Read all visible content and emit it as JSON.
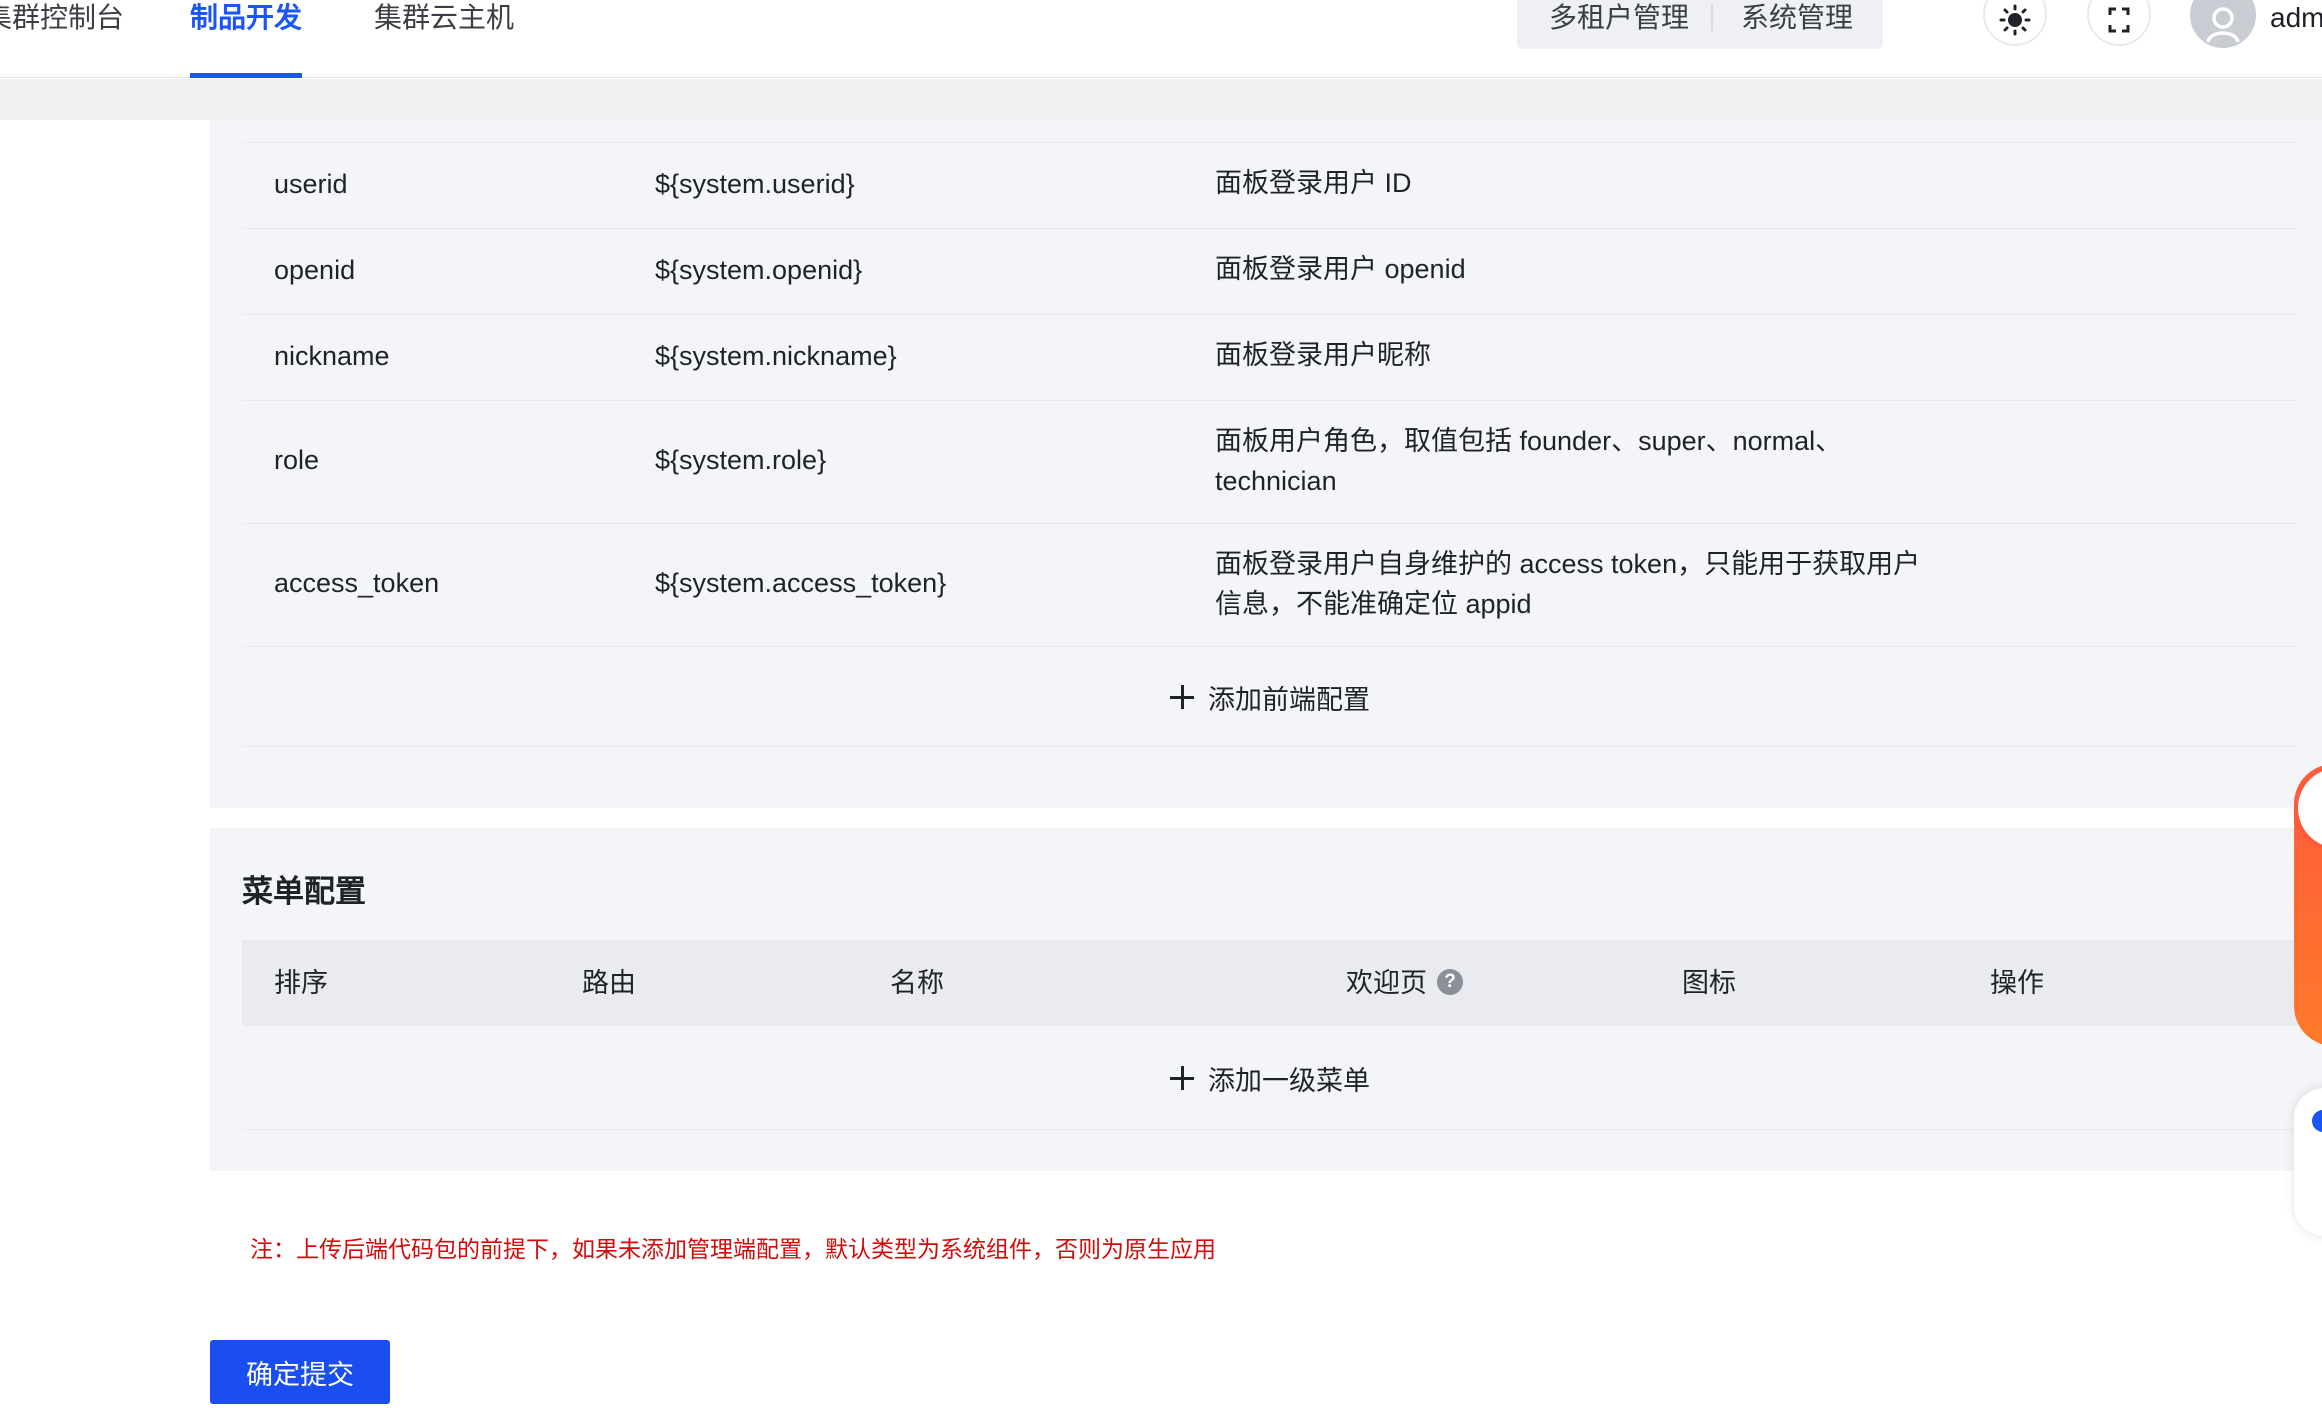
{
  "nav": {
    "tabs": [
      {
        "label": "集群控制台",
        "active": false
      },
      {
        "label": "制品开发",
        "active": true
      },
      {
        "label": "集群云主机",
        "active": false
      }
    ],
    "segment": {
      "items": [
        "多租户管理",
        "系统管理"
      ]
    },
    "theme_icon": "sun-icon",
    "fullscreen_icon": "fullscreen-icon",
    "user": {
      "name": "adm",
      "avatar_icon": "user-avatar-icon"
    }
  },
  "frontend_config": {
    "rows": [
      {
        "key": "userid",
        "variable": "${system.userid}",
        "description": "面板登录用户 ID"
      },
      {
        "key": "openid",
        "variable": "${system.openid}",
        "description": "面板登录用户 openid"
      },
      {
        "key": "nickname",
        "variable": "${system.nickname}",
        "description": "面板登录用户昵称"
      },
      {
        "key": "role",
        "variable": "${system.role}",
        "description": "面板用户角色，取值包括 founder、super、normal、technician"
      },
      {
        "key": "access_token",
        "variable": "${system.access_token}",
        "description": "面板登录用户自身维护的 access token，只能用于获取用户信息，不能准确定位 appid"
      }
    ],
    "add_label": "添加前端配置"
  },
  "menu_config": {
    "title": "菜单配置",
    "columns": [
      "排序",
      "路由",
      "名称",
      "欢迎页",
      "图标",
      "操作"
    ],
    "help_glyph": "?",
    "add_label": "添加一级菜单"
  },
  "note": "注：上传后端代码包的前提下，如果未添加管理端配置，默认类型为系统组件，否则为原生应用",
  "submit_label": "确定提交",
  "colors": {
    "primary": "#1a55f5",
    "submit": "#1a4ef0",
    "note": "#d40b0b",
    "panel_bg": "#f4f5f8",
    "header_row_bg": "#e9ebf0"
  }
}
